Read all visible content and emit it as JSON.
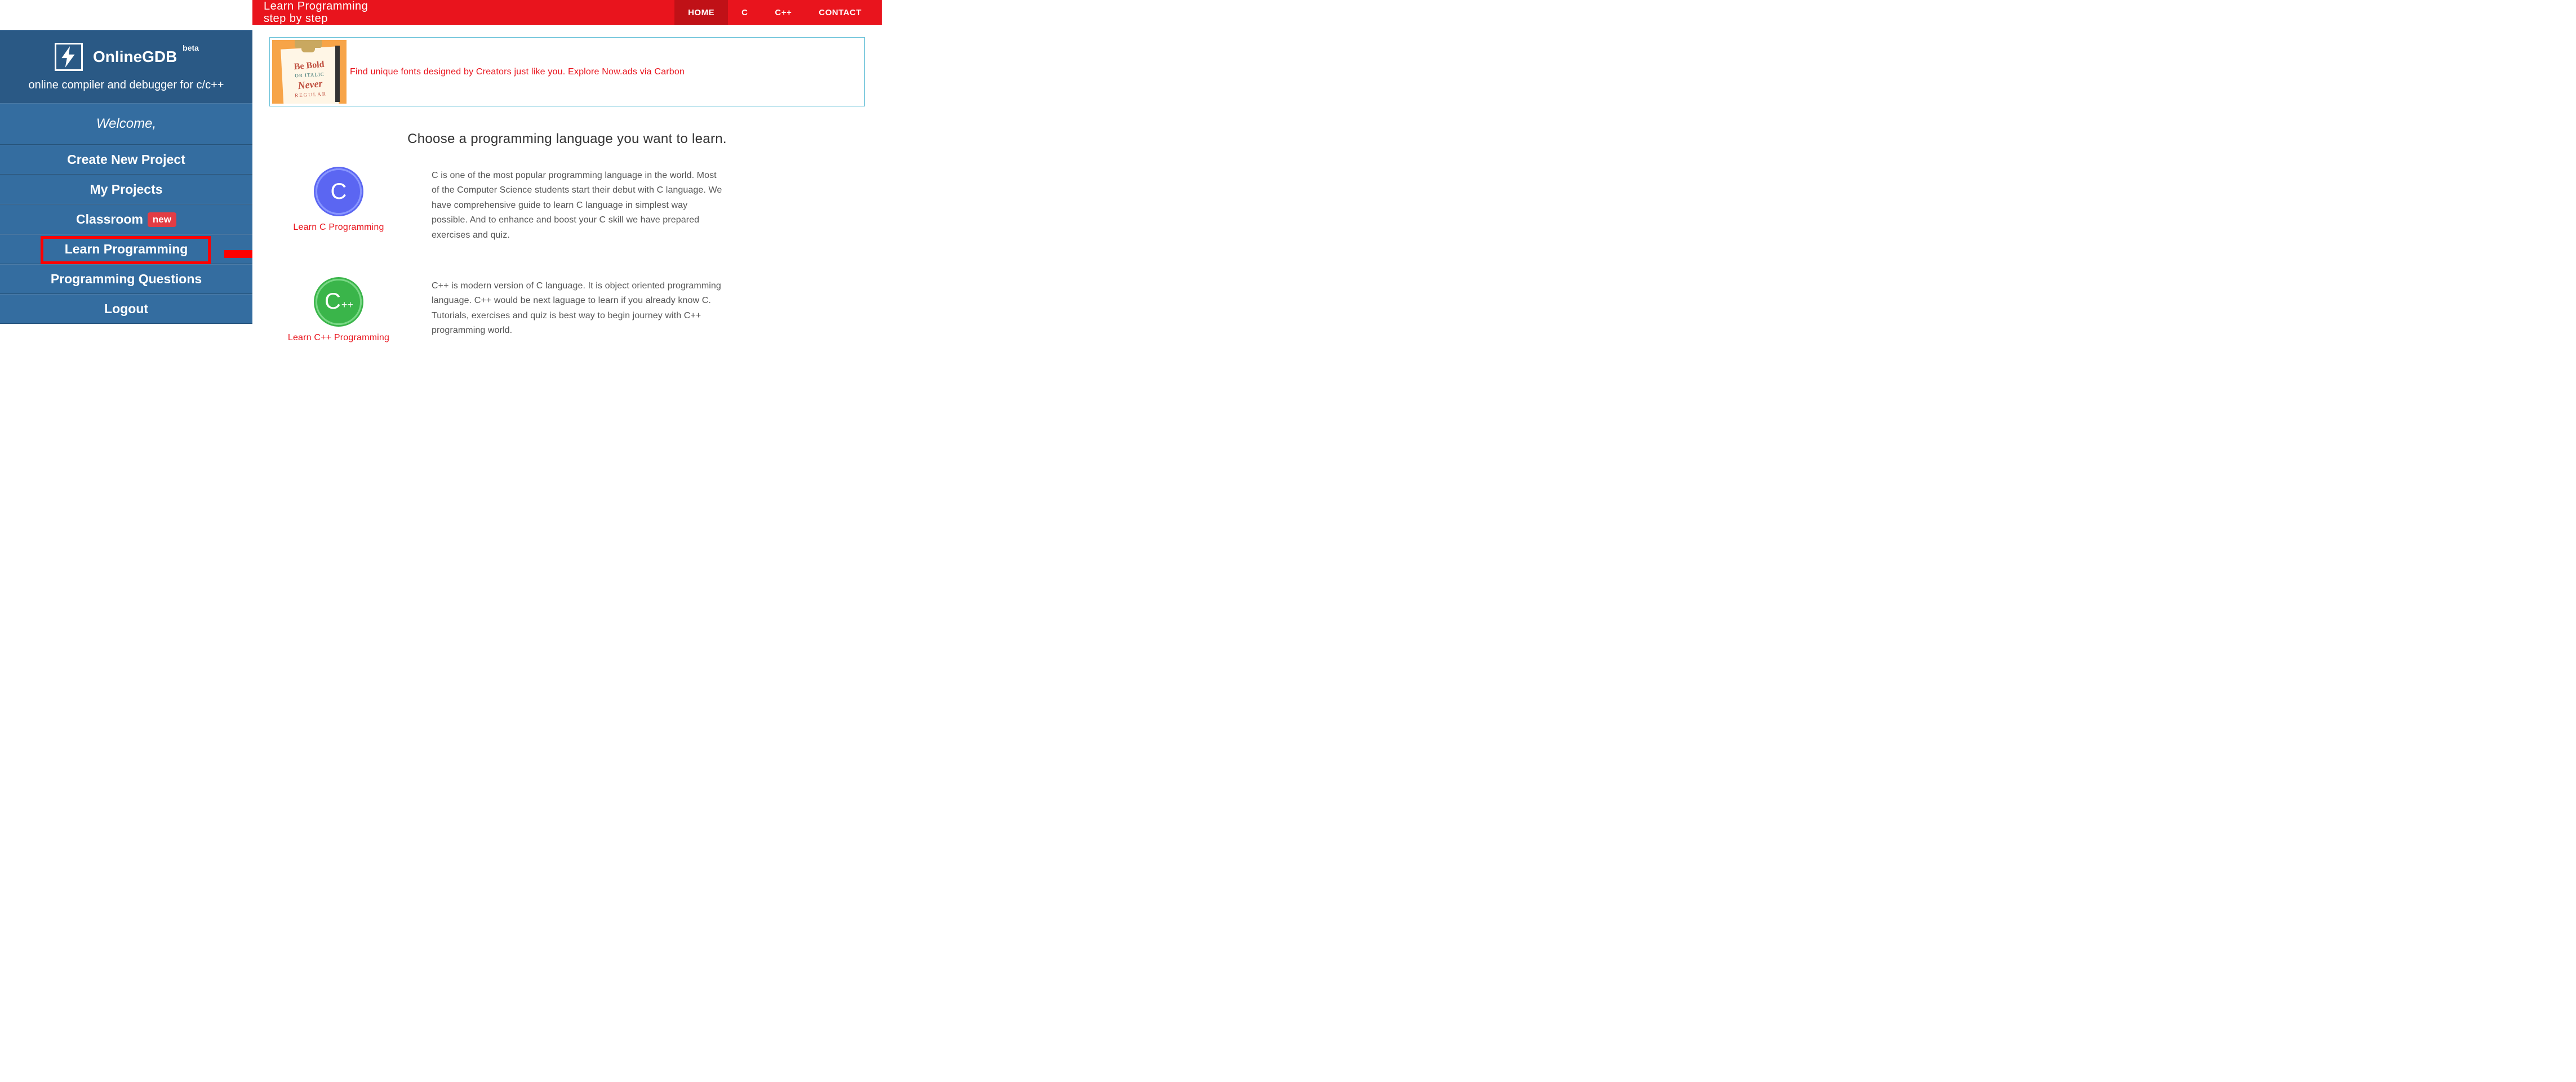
{
  "sidebar": {
    "brand": "OnlineGDB",
    "brand_sup": "beta",
    "subtitle": "online compiler and debugger for c/c++",
    "welcome": "Welcome,",
    "items": [
      {
        "label": "Create New Project",
        "highlighted": false,
        "badge": null
      },
      {
        "label": "My Projects",
        "highlighted": false,
        "badge": null
      },
      {
        "label": "Classroom",
        "highlighted": false,
        "badge": "new"
      },
      {
        "label": "Learn Programming",
        "highlighted": true,
        "badge": null
      },
      {
        "label": "Programming Questions",
        "highlighted": false,
        "badge": null
      },
      {
        "label": "Logout",
        "highlighted": false,
        "badge": null
      }
    ]
  },
  "topbar": {
    "title_line1": "Learn Programming",
    "title_line2": "step by step",
    "nav": [
      {
        "label": "HOME",
        "active": true
      },
      {
        "label": "C",
        "active": false
      },
      {
        "label": "C++",
        "active": false
      },
      {
        "label": "CONTACT",
        "active": false
      }
    ]
  },
  "ad": {
    "text": "Find unique fonts designed by Creators just like you. Explore Now.ads via Carbon",
    "creative": {
      "l1": "Be Bold",
      "l2": "OR ITALIC",
      "l3": "Never",
      "l4": "REGULAR"
    }
  },
  "heading": "Choose a programming language you want to learn.",
  "languages": [
    {
      "letter": "C",
      "plus": "",
      "cls": "c",
      "link": "Learn C Programming",
      "desc": "C is one of the most popular programming language in the world. Most of the Computer Science students start their debut with C language. We have comprehensive guide to learn C language in simplest way possible. And to enhance and boost your C skill we have prepared exercises and quiz."
    },
    {
      "letter": "C",
      "plus": "++",
      "cls": "cpp",
      "link": "Learn C++ Programming",
      "desc": "C++ is modern version of C language. It is object oriented programming language. C++ would be next laguage to learn if you already know C. Tutorials, exercises and quiz is best way to begin journey with C++ programming world."
    }
  ]
}
